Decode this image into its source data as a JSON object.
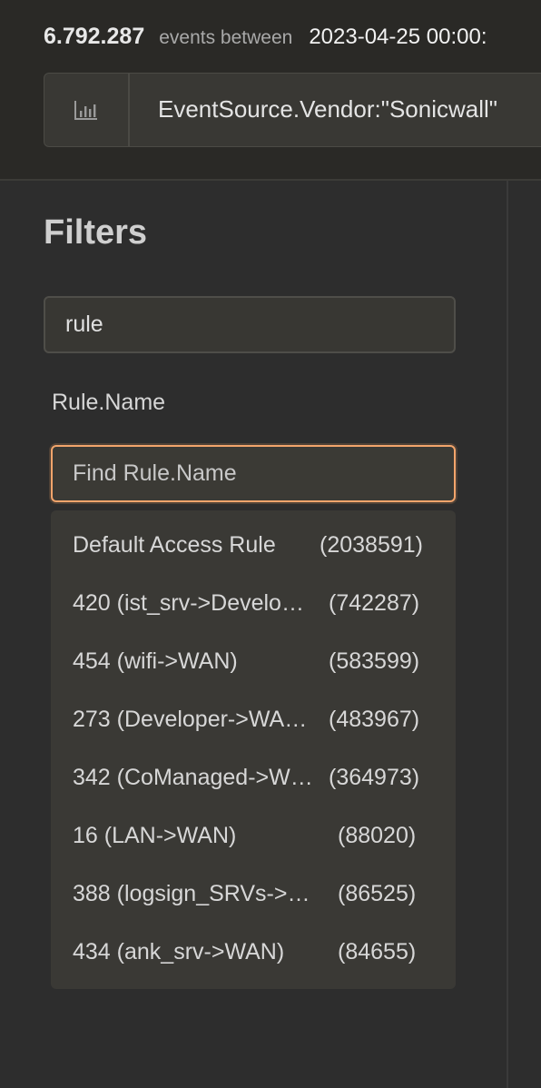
{
  "header": {
    "event_count": "6.792.287",
    "between_label": "events between",
    "date_range": "2023-04-25 00:00:",
    "query": "EventSource.Vendor:\"Sonicwall\"",
    "chart_icon": "bar-chart-icon"
  },
  "filters": {
    "title": "Filters",
    "search_value": "rule",
    "section_label": "Rule.Name",
    "find_placeholder": "Find Rule.Name",
    "options": [
      {
        "label": "Default Access Rule",
        "count": "(2038591)"
      },
      {
        "label": "420 (ist_srv->Develo…",
        "count": "(742287)"
      },
      {
        "label": "454 (wifi->WAN)",
        "count": "(583599)"
      },
      {
        "label": "273 (Developer->WA…",
        "count": "(483967)"
      },
      {
        "label": "342 (CoManaged->W…",
        "count": "(364973)"
      },
      {
        "label": "16 (LAN->WAN)",
        "count": "(88020)"
      },
      {
        "label": "388 (logsign_SRVs->…",
        "count": "(86525)"
      },
      {
        "label": "434 (ank_srv->WAN)",
        "count": "(84655)"
      }
    ]
  },
  "colors": {
    "accent_focus": "#f2a46b",
    "background": "#2d2d2d",
    "header_background": "#2a2926"
  }
}
